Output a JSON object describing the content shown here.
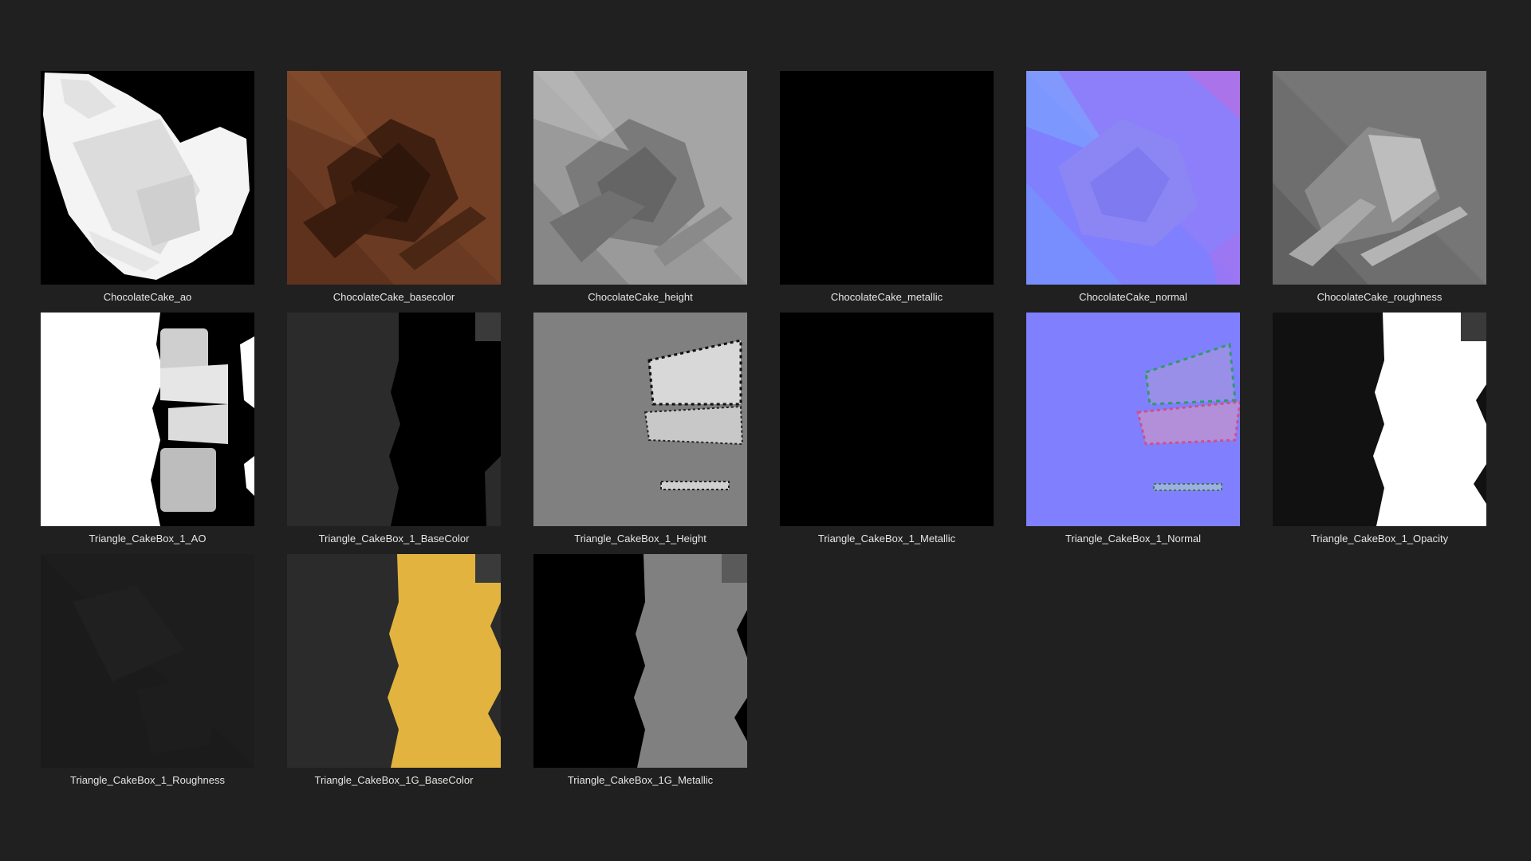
{
  "files": [
    {
      "name": "ChocolateCake_ao",
      "icon": "ao-map-thumbnail"
    },
    {
      "name": "ChocolateCake_basecolor",
      "icon": "basecolor-map-thumbnail"
    },
    {
      "name": "ChocolateCake_height",
      "icon": "height-map-thumbnail"
    },
    {
      "name": "ChocolateCake_metallic",
      "icon": "metallic-map-thumbnail"
    },
    {
      "name": "ChocolateCake_normal",
      "icon": "normal-map-thumbnail"
    },
    {
      "name": "ChocolateCake_roughness",
      "icon": "roughness-map-thumbnail"
    },
    {
      "name": "Triangle_CakeBox_1_AO",
      "icon": "ao-map-thumbnail"
    },
    {
      "name": "Triangle_CakeBox_1_BaseColor",
      "icon": "basecolor-map-thumbnail"
    },
    {
      "name": "Triangle_CakeBox_1_Height",
      "icon": "height-map-thumbnail"
    },
    {
      "name": "Triangle_CakeBox_1_Metallic",
      "icon": "metallic-map-thumbnail"
    },
    {
      "name": "Triangle_CakeBox_1_Normal",
      "icon": "normal-map-thumbnail"
    },
    {
      "name": "Triangle_CakeBox_1_Opacity",
      "icon": "opacity-map-thumbnail"
    },
    {
      "name": "Triangle_CakeBox_1_Roughness",
      "icon": "roughness-map-thumbnail"
    },
    {
      "name": "Triangle_CakeBox_1G_BaseColor",
      "icon": "basecolor-map-thumbnail"
    },
    {
      "name": "Triangle_CakeBox_1G_Metallic",
      "icon": "metallic-map-thumbnail"
    }
  ],
  "colors": {
    "background": "#202020",
    "label": "#e6e6e6",
    "normal_blue": "#8080ff",
    "box_yellow": "#e2b43f",
    "cake_brown": "#6b3a22"
  }
}
